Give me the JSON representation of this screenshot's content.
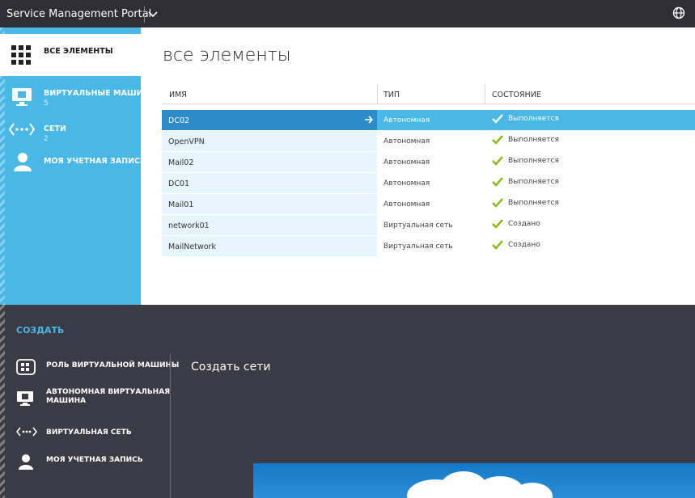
{
  "topbar": {
    "title": "Service Management Portal"
  },
  "sidebar": {
    "items": [
      {
        "label": "ВСЕ ЭЛЕМЕНТЫ",
        "count": ""
      },
      {
        "label": "ВИРТУАЛЬНЫЕ МАШИНЫ",
        "count": "5"
      },
      {
        "label": "СЕТИ",
        "count": "2"
      },
      {
        "label": "МОЯ УЧЕТНАЯ ЗАПИСЬ",
        "count": ""
      }
    ]
  },
  "main": {
    "title": "все элементы",
    "columns": [
      "ИМЯ",
      "ТИП",
      "СОСТОЯНИЕ"
    ],
    "rows": [
      {
        "name": "DC02",
        "type": "Автономная",
        "status": "Выполняется"
      },
      {
        "name": "OpenVPN",
        "type": "Автономная",
        "status": "Выполняется"
      },
      {
        "name": "Mail02",
        "type": "Автономная",
        "status": "Выполняется"
      },
      {
        "name": "DC01",
        "type": "Автономная",
        "status": "Выполняется"
      },
      {
        "name": "Mail01",
        "type": "Автономная",
        "status": "Выполняется"
      },
      {
        "name": "network01",
        "type": "Виртуальная сеть",
        "status": "Создано"
      },
      {
        "name": "MailNetwork",
        "type": "Виртуальная сеть",
        "status": "Создано"
      }
    ]
  },
  "create": {
    "title": "СОЗДАТЬ",
    "items": [
      {
        "label": "РОЛЬ ВИРТУАЛЬНОЙ МАШИНЫ",
        "icon": "vm-role-icon"
      },
      {
        "label": "АВТОНОМНАЯ ВИРТУАЛЬНАЯ",
        "label2": "МАШИНА",
        "icon": "vm-icon"
      },
      {
        "label": "ВИРТУАЛЬНАЯ СЕТЬ",
        "icon": "network-icon"
      },
      {
        "label": "МОЯ УЧЕТНАЯ ЗАПИСЬ",
        "icon": "user-icon"
      }
    ],
    "heading": "Создать сети"
  },
  "colors": {
    "accent": "#4ab8e6",
    "selected": "#2c8cc8",
    "check": "#7fba00",
    "dark": "#3a3b44"
  }
}
